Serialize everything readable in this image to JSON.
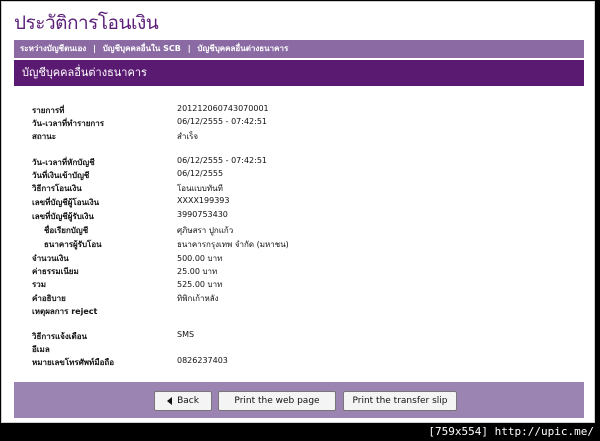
{
  "header": {
    "title": "ประวัติการโอนเงิน"
  },
  "nav": {
    "items": [
      "ระหว่างบัญชีตนเอง",
      "บัญชีบุคคลอื่นใน SCB",
      "บัญชีบุคคลอื่นต่างธนาคาร"
    ],
    "separator": "|"
  },
  "section": {
    "title": "บัญชีบุคคลอื่นต่างธนาคาร"
  },
  "details": {
    "ref_label": "รายการที่",
    "ref_value": "201212060743070001",
    "txn_datetime_label": "วัน-เวลาที่ทำรายการ",
    "txn_datetime_value": "06/12/2555 - 07:42:51",
    "status_label": "สถานะ",
    "status_value": "สำเร็จ",
    "debit_datetime_label": "วัน-เวลาที่หักบัญชี",
    "debit_datetime_value": "06/12/2555 - 07:42:51",
    "credit_date_label": "วันที่เงินเข้าบัญชี",
    "credit_date_value": "06/12/2555",
    "method_label": "วิธีการโอนเงิน",
    "method_value": "โอนแบบทันที",
    "from_acct_label": "เลขที่บัญชีผู้โอนเงิน",
    "from_acct_value": "XXXX199393",
    "to_acct_label": "เลขที่บัญชีผู้รับเงิน",
    "to_acct_value": "3990753430",
    "acct_name_label": "ชื่อเรียกบัญชี",
    "acct_name_value": "ศุภิษสรา ปูกแก้ว",
    "bank_label": "ธนาคารผู้รับโอน",
    "bank_value": "ธนาคารกรุงเทพ จำกัด (มหาชน)",
    "amount_label": "จำนวนเงิน",
    "amount_value": "500.00  บาท",
    "fee_label": "ค่าธรรมเนียม",
    "fee_value": "25.00  บาท",
    "total_label": "รวม",
    "total_value": "525.00  บาท",
    "desc_label": "คำอธิบาย",
    "desc_value": "ทิพิกเก้าหลัง",
    "reject_label": "เหตุผลการ reject",
    "reject_value": "",
    "notify_label": "วิธีการแจ้งเตือน",
    "notify_value": "SMS",
    "email_label": "อีเมล",
    "email_value": "",
    "mobile_label": "หมายเลขโทรศัพท์มือถือ",
    "mobile_value": "0826237403"
  },
  "buttons": {
    "back": "Back",
    "print_web": "Print the web page",
    "print_slip": "Print the transfer slip"
  },
  "caption": "[759x554] http://upic.me/"
}
